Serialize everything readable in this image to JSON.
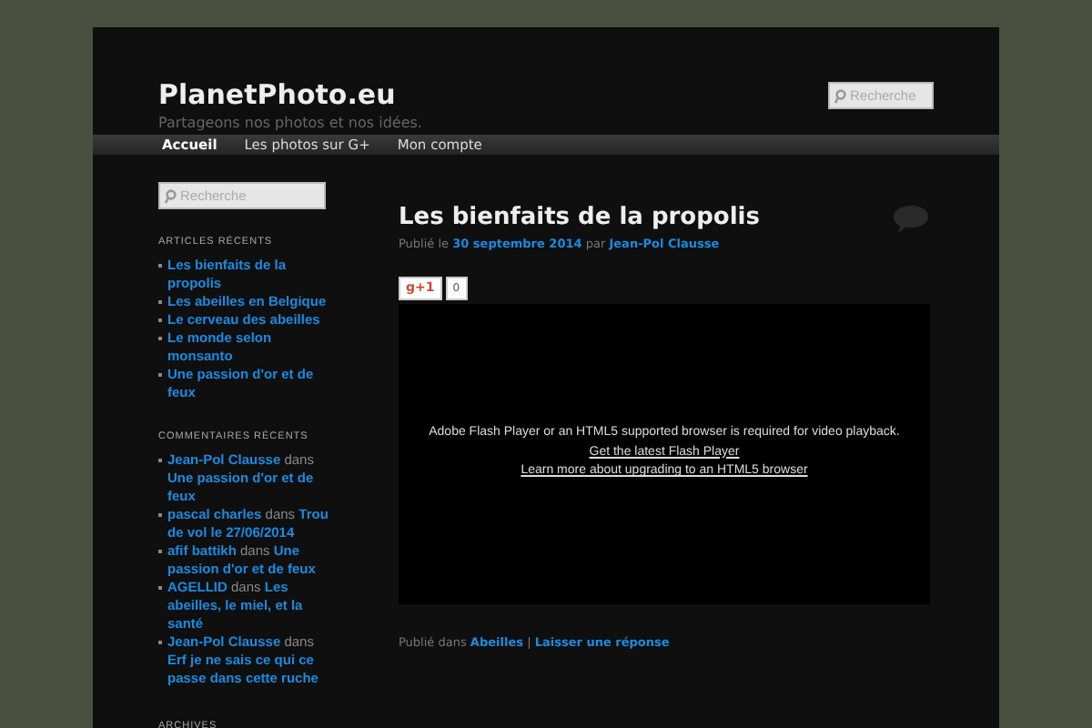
{
  "site": {
    "title": "PlanetPhoto.eu",
    "tagline": "Partageons nos photos et nos idées.",
    "search_placeholder": "Recherche"
  },
  "nav": [
    {
      "label": "Accueil",
      "selected": true
    },
    {
      "label": "Les photos sur G+",
      "selected": false
    },
    {
      "label": "Mon compte",
      "selected": false
    }
  ],
  "sidebar": {
    "search_placeholder": "Recherche",
    "recent_posts_title": "ARTICLES RÉCENTS",
    "recent_posts": [
      "Les bienfaits de la propolis",
      "Les abeilles en Belgique",
      "Le cerveau des abeilles",
      "Le monde selon monsanto",
      "Une passion d'or et de feux"
    ],
    "recent_comments_title": "COMMENTAIRES RÉCENTS",
    "recent_comments": [
      {
        "author": "Jean-Pol Clausse",
        "joiner": "dans",
        "post": "Une passion d'or et de feux"
      },
      {
        "author": "pascal charles",
        "joiner": "dans",
        "post": "Trou de vol le 27/06/2014"
      },
      {
        "author": "afif battikh",
        "joiner": "dans",
        "post": "Une passion d'or et de feux"
      },
      {
        "author": "AGELLID",
        "joiner": "dans",
        "post": "Les abeilles, le miel, et la santé"
      },
      {
        "author": "Jean-Pol Clausse",
        "joiner": "dans",
        "post": "Erf je ne sais ce qui ce passe dans cette ruche"
      }
    ],
    "archives_title": "ARCHIVES"
  },
  "post": {
    "title": "Les bienfaits de la propolis",
    "published_prefix": "Publié le",
    "date": "30 septembre 2014",
    "by": "par",
    "author": "Jean-Pol Clausse",
    "plus_label": "g+1",
    "plus_count": "0",
    "video": {
      "message": "Adobe Flash Player or an HTML5 supported browser is required for video playback.",
      "link_flash": "Get the latest Flash Player",
      "link_html5": "Learn more about upgrading to an HTML5 browser"
    },
    "footer_prefix": "Publié dans",
    "category": "Abeilles",
    "separator": "|",
    "reply_link": "Laisser une réponse"
  }
}
